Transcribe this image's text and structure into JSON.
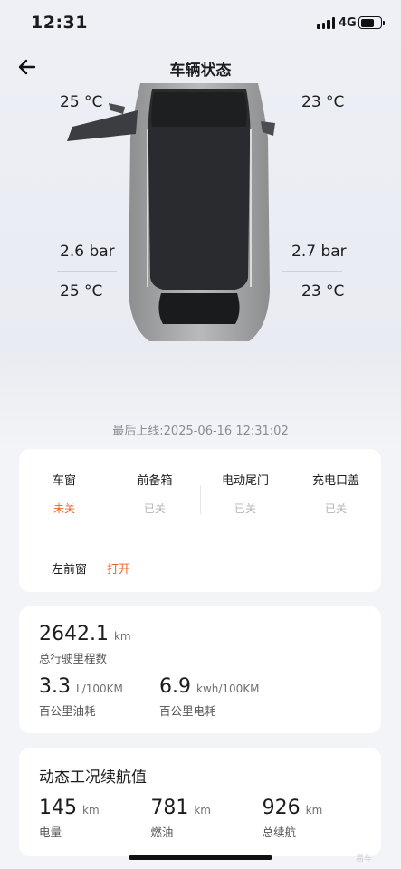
{
  "status_bar": {
    "time": "12:31",
    "network": "4G"
  },
  "header": {
    "title": "车辆状态"
  },
  "car": {
    "front_left_temp": "25 °C",
    "front_right_temp": "23 °C",
    "rear_left_pressure": "2.6 bar",
    "rear_right_pressure": "2.7 bar",
    "rear_left_temp": "25 °C",
    "rear_right_temp": "23 °C"
  },
  "last_online": "最后上线:2025-06-16 12:31:02",
  "status": {
    "items": [
      {
        "label": "车窗",
        "value": "未关"
      },
      {
        "label": "前备箱",
        "value": "已关"
      },
      {
        "label": "电动尾门",
        "value": "已关"
      },
      {
        "label": "充电口盖",
        "value": "已关"
      }
    ],
    "window_detail": {
      "label": "左前窗",
      "value": "打开"
    },
    "warning_color": "#e5672a"
  },
  "stats": {
    "odometer": {
      "value": "2642.1",
      "unit": "km",
      "label": "总行驶里程数"
    },
    "fuel": {
      "value": "3.3",
      "unit": "L/100KM",
      "label": "百公里油耗"
    },
    "electric": {
      "value": "6.9",
      "unit": "kwh/100KM",
      "label": "百公里电耗"
    }
  },
  "range": {
    "title": "动态工况续航值",
    "items": [
      {
        "value": "145",
        "unit": "km",
        "label": "电量"
      },
      {
        "value": "781",
        "unit": "km",
        "label": "燃油"
      },
      {
        "value": "926",
        "unit": "km",
        "label": "总续航"
      }
    ]
  },
  "watermark": "易车"
}
